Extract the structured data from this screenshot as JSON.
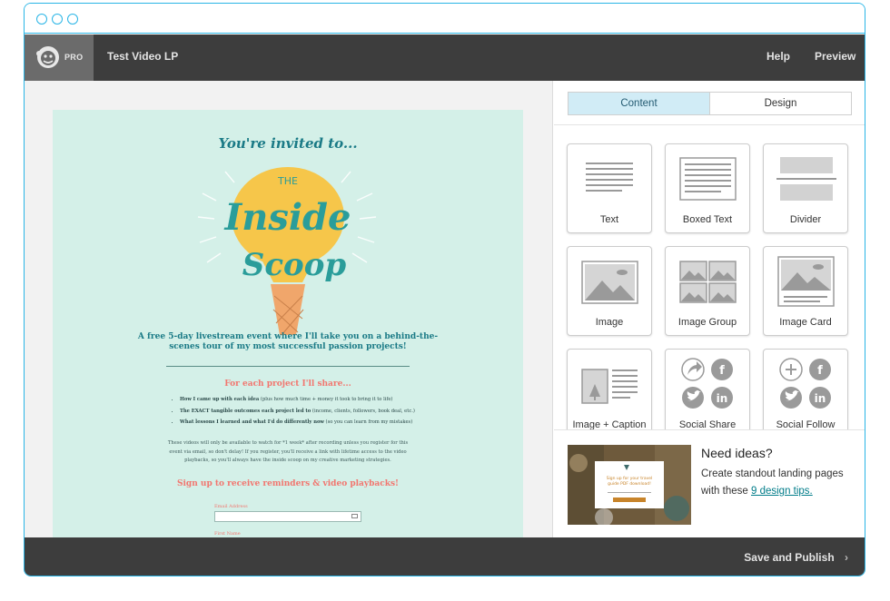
{
  "header": {
    "pro_badge": "PRO",
    "title": "Test Video LP",
    "help": "Help",
    "preview": "Preview"
  },
  "landing_page": {
    "invite": "You're invited to...",
    "art_text": {
      "line1": "THE",
      "line2": "Inside",
      "line3": "Scoop"
    },
    "tagline_1": "A free 5-day livestream event where I'll take you on a behind-the-",
    "tagline_2": "scenes tour of my most successful passion projects!",
    "for_each_heading": "For each project I'll share...",
    "bullets": [
      {
        "bold": "How I came up with each idea",
        "rest": " (plus how much time + money it took to bring it to life)"
      },
      {
        "bold": "The EXACT tangible outcomes each project led to",
        "rest": " (income, clients, followers, book deal, etc.)"
      },
      {
        "bold": "What lessons I learned and what I'd do differently now",
        "rest": " (so you can learn from my mistakes)"
      }
    ],
    "body_1": "These videos will only be available to watch for *1 week* after recording unless you register for this",
    "body_2": "event via email, so don't delay! If you register, you'll receive a link with lifetime access to the video",
    "body_3": "playbacks, so you'll always have the inside scoop on my creative marketing strategies.",
    "signup_heading": "Sign up to receive reminders & video playbacks!",
    "email_label": "Email Address",
    "first_name_label": "First Name"
  },
  "panel": {
    "tabs": [
      "Content",
      "Design"
    ],
    "blocks": [
      "Text",
      "Boxed Text",
      "Divider",
      "Image",
      "Image Group",
      "Image Card",
      "Image + Caption",
      "Social Share",
      "Social Follow"
    ],
    "ideas_title": "Need ideas?",
    "ideas_text": "Create standout landing pages with these",
    "ideas_link": "9 design tips.",
    "ideas_card_text_1": "Sign up for your travel",
    "ideas_card_text_2": "guide PDF download!"
  },
  "footer": {
    "save_publish": "Save and Publish"
  },
  "colors": {
    "accent": "#29b5e6",
    "topbar": "#3d3d3d",
    "lp_background": "#d4f0e8",
    "teal_text": "#1a7a86",
    "coral_text": "#f2766f",
    "link": "#007c89"
  }
}
